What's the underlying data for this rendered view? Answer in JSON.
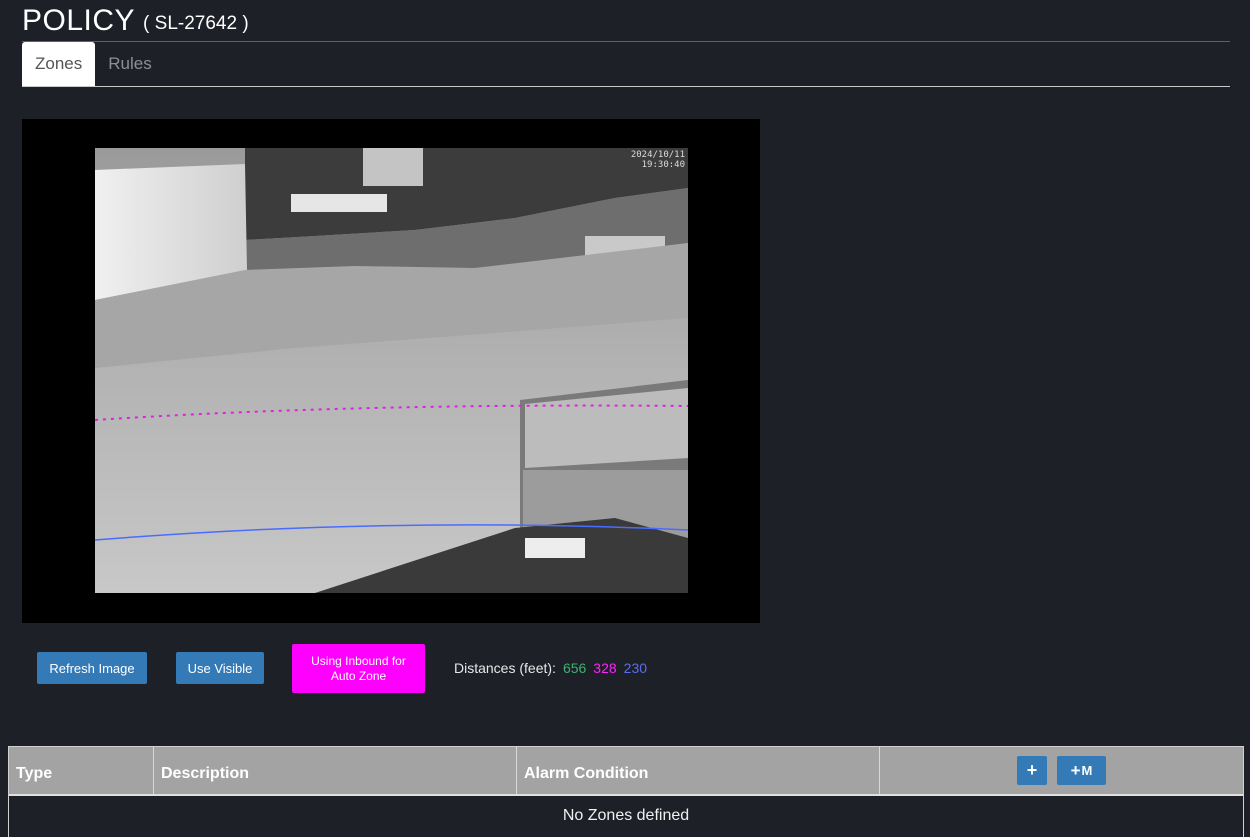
{
  "header": {
    "title": "POLICY",
    "policy_id": "( SL-27642 )"
  },
  "tabs": [
    {
      "label": "Zones",
      "active": true
    },
    {
      "label": "Rules",
      "active": false
    }
  ],
  "camera": {
    "timestamp_date": "2024/10/11",
    "timestamp_time": "19:30:40"
  },
  "controls": {
    "refresh_label": "Refresh Image",
    "visible_label": "Use Visible",
    "inbound_label": "Using Inbound for Auto Zone",
    "distances_label": "Distances (feet):",
    "distances": [
      {
        "value": "656",
        "color": "#3cb371"
      },
      {
        "value": "328",
        "color": "#ff22ff"
      },
      {
        "value": "230",
        "color": "#5a6ee6"
      }
    ]
  },
  "table": {
    "columns": [
      "Type",
      "Description",
      "Alarm Condition"
    ],
    "add_icon": "plus-icon",
    "add_multi_label": "M",
    "empty_message": "No Zones defined"
  },
  "colors": {
    "accent": "#337ab7",
    "inbound": "#ff00ff",
    "background": "#1e2028"
  }
}
